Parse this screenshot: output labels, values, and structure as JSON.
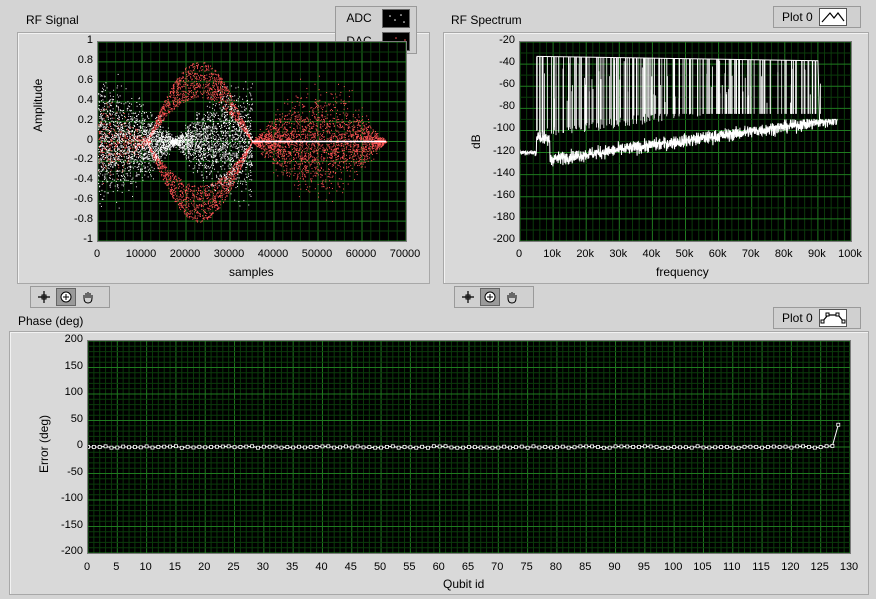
{
  "rf_signal": {
    "title": "RF Signal",
    "legend": [
      {
        "label": "ADC",
        "color": "#ffffff"
      },
      {
        "label": "DAC",
        "color": "#ff5555"
      }
    ],
    "chart_data": {
      "type": "scatter",
      "xlabel": "samples",
      "ylabel": "Amplitude",
      "xlim": [
        0,
        70000
      ],
      "ylim": [
        -1,
        1
      ],
      "x_ticks": [
        "0",
        "10000",
        "20000",
        "30000",
        "40000",
        "50000",
        "60000",
        "70000"
      ],
      "y_ticks": [
        "1",
        "0.8",
        "0.6",
        "0.4",
        "0.2",
        "0",
        "-0.2",
        "-0.4",
        "-0.6",
        "-0.8",
        "-1"
      ],
      "grid": true,
      "series": [
        {
          "name": "ADC"
        },
        {
          "name": "DAC"
        }
      ]
    }
  },
  "rf_spectrum": {
    "title": "RF Spectrum",
    "plot_label": "Plot 0",
    "chart_data": {
      "type": "line",
      "xlabel": "frequency",
      "ylabel": "dB",
      "xlim": [
        0,
        100000
      ],
      "ylim": [
        -200,
        -20
      ],
      "x_ticks": [
        "0",
        "10k",
        "20k",
        "30k",
        "40k",
        "50k",
        "60k",
        "70k",
        "80k",
        "90k",
        "100k"
      ],
      "y_ticks": [
        "-20",
        "-40",
        "-60",
        "-80",
        "-100",
        "-120",
        "-140",
        "-160",
        "-180",
        "-200"
      ],
      "grid": true,
      "series": [
        {
          "name": "Plot 0"
        }
      ]
    }
  },
  "phase": {
    "title": "Phase (deg)",
    "plot_label": "Plot 0",
    "chart_data": {
      "type": "line",
      "xlabel": "Qubit id",
      "ylabel": "Error (deg)",
      "xlim": [
        0,
        130
      ],
      "ylim": [
        -200,
        200
      ],
      "x_ticks": [
        "0",
        "5",
        "10",
        "15",
        "20",
        "25",
        "30",
        "35",
        "40",
        "45",
        "50",
        "55",
        "60",
        "65",
        "70",
        "75",
        "80",
        "85",
        "90",
        "95",
        "100",
        "105",
        "110",
        "115",
        "120",
        "125",
        "130"
      ],
      "y_ticks": [
        "200",
        "150",
        "100",
        "50",
        "0",
        "-50",
        "-100",
        "-150",
        "-200"
      ],
      "grid": true,
      "series": [
        {
          "name": "Plot 0",
          "x_range": [
            0,
            128
          ],
          "values_summary": "approximately 0 for qubits 0-126, rising to about 42 at qubit 128"
        }
      ]
    }
  }
}
